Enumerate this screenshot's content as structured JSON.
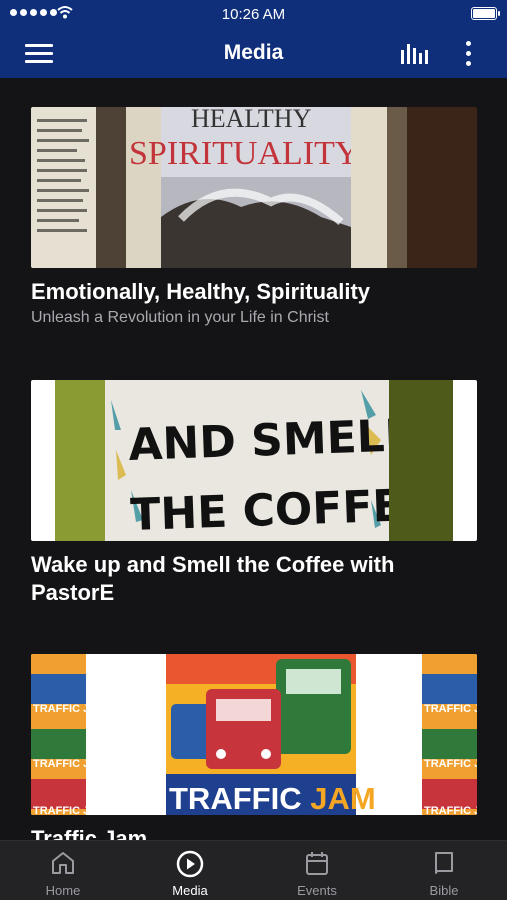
{
  "status": {
    "time": "10:26 AM"
  },
  "header": {
    "title": "Media"
  },
  "media": [
    {
      "title": "Emotionally, Healthy, Spirituality",
      "subtitle": "Unleash a Revolution in your Life in Christ",
      "thumb_text": [
        "HEALTHY",
        "SPIRITUALITY"
      ]
    },
    {
      "title": "Wake up and Smell the Coffee with PastorE",
      "subtitle": "",
      "thumb_text": [
        "AND SMELL",
        "THE COFFEE"
      ]
    },
    {
      "title": "Traffic Jam",
      "subtitle": "",
      "thumb_text": [
        "TRAFFIC ",
        "JAM"
      ]
    }
  ],
  "tabs": [
    {
      "label": "Home",
      "icon": "home-icon"
    },
    {
      "label": "Media",
      "icon": "play-circle-icon",
      "active": true
    },
    {
      "label": "Events",
      "icon": "calendar-icon"
    },
    {
      "label": "Bible",
      "icon": "book-icon"
    }
  ],
  "colors": {
    "appbar": "#0f2f7a",
    "background": "#141416",
    "tabbar": "#232326",
    "subtitle": "#a9a9b0"
  }
}
